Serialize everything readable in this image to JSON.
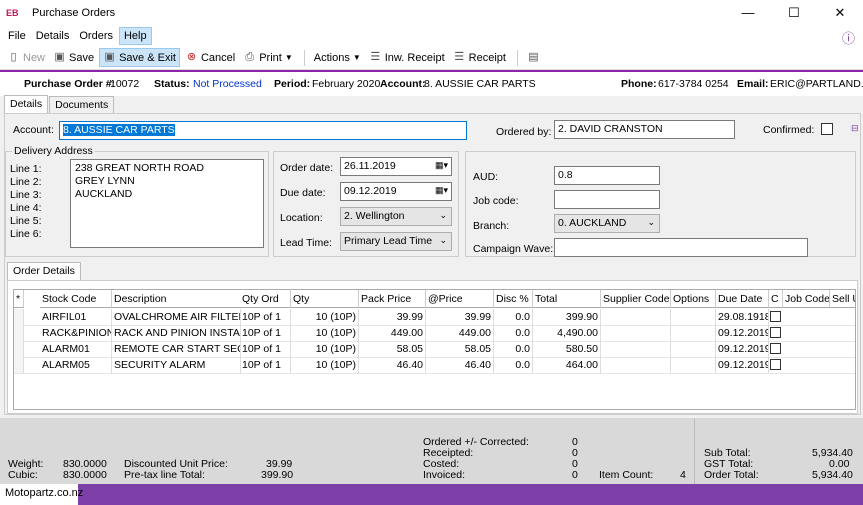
{
  "window": {
    "icon": "EB",
    "title": "Purchase Orders",
    "minimize": "—",
    "maximize": "☐",
    "close": "✕"
  },
  "menu": [
    "File",
    "Details",
    "Orders",
    "Help"
  ],
  "info_icon": "ⓘ",
  "toolbar": {
    "new": "New",
    "save": "Save",
    "save_exit": "Save & Exit",
    "cancel": "Cancel",
    "print": "Print",
    "actions": "Actions",
    "inw_receipt": "Inw. Receipt",
    "receipt": "Receipt"
  },
  "header": {
    "po_label": "Purchase Order #:",
    "po_value": "10072",
    "status_label": "Status:",
    "status_value": "Not Processed",
    "period_label": "Period:",
    "period_value": "February 2020",
    "account_label": "Account:",
    "account_value": "8. AUSSIE CAR PARTS",
    "phone_label": "Phone:",
    "phone_value": "617-3784 0254",
    "email_label": "Email:",
    "email_value": "ERIC@PARTLAND.exa"
  },
  "tabs": {
    "details": "Details",
    "documents": "Documents",
    "order_details": "Order Details"
  },
  "form": {
    "account_label": "Account:",
    "account_value": "8. AUSSIE CAR PARTS",
    "ordered_by_label": "Ordered by:",
    "ordered_by_value": "2. DAVID CRANSTON",
    "confirmed_label": "Confirmed:",
    "delivery_title": "Delivery Address",
    "lines": [
      "Line 1:",
      "Line 2:",
      "Line 3:",
      "Line 4:",
      "Line 5:",
      "Line 6:"
    ],
    "address": [
      "238 GREAT NORTH ROAD",
      "GREY LYNN",
      "AUCKLAND"
    ],
    "order_date_label": "Order date:",
    "order_date": "26.11.2019",
    "due_date_label": "Due date:",
    "due_date": "09.12.2019",
    "location_label": "Location:",
    "location": "2. Wellington",
    "lead_time_label": "Lead Time:",
    "lead_time": "Primary Lead Time",
    "aud_label": "AUD:",
    "aud": "0.8",
    "job_code_label": "Job code:",
    "branch_label": "Branch:",
    "branch": "0. AUCKLAND",
    "campaign_label": "Campaign Wave:"
  },
  "grid": {
    "headers": [
      "*",
      "Stock Code",
      "Description",
      "Qty Ord",
      "Qty",
      "Pack Price",
      "@Price",
      "Disc %",
      "Total",
      "Supplier Code",
      "Options",
      "Due Date",
      "C",
      "Job Code",
      "Sell U"
    ],
    "rows": [
      [
        "AIRFIL01",
        "OVALCHROME AIR FILTER",
        "10P of 1",
        "10 (10P)",
        "39.99",
        "39.99",
        "0.0",
        "399.90",
        "",
        "",
        "29.08.1918"
      ],
      [
        "RACK&PINION",
        "RACK AND PINION INSTALL",
        "10P of 1",
        "10 (10P)",
        "449.00",
        "449.00",
        "0.0",
        "4,490.00",
        "",
        "",
        "09.12.2019"
      ],
      [
        "ALARM01",
        "REMOTE CAR START SECUR",
        "10P of 1",
        "10 (10P)",
        "58.05",
        "58.05",
        "0.0",
        "580.50",
        "",
        "",
        "09.12.2019"
      ],
      [
        "ALARM05",
        "SECURITY ALARM",
        "10P of 1",
        "10 (10P)",
        "46.40",
        "46.40",
        "0.0",
        "464.00",
        "",
        "",
        "09.12.2019"
      ]
    ]
  },
  "footer": {
    "weight_label": "Weight:",
    "weight": "830.0000",
    "cubic_label": "Cubic:",
    "cubic": "830.0000",
    "disc_unit_label": "Discounted Unit Price:",
    "disc_unit": "39.99",
    "pretax_label": "Pre-tax line Total:",
    "pretax": "399.90",
    "ordered_corr_label": "Ordered +/- Corrected:",
    "ordered_corr": "0",
    "receipted_label": "Receipted:",
    "receipted": "0",
    "costed_label": "Costed:",
    "costed": "0",
    "invoiced_label": "Invoiced:",
    "invoiced": "0",
    "item_count_label": "Item Count:",
    "item_count": "4",
    "subtotal_label": "Sub Total:",
    "subtotal": "5,934.40",
    "gst_label": "GST Total:",
    "gst": "0.00",
    "order_total_label": "Order Total:",
    "order_total": "5,934.40"
  },
  "status_bar": "Motopartz.co.nz"
}
